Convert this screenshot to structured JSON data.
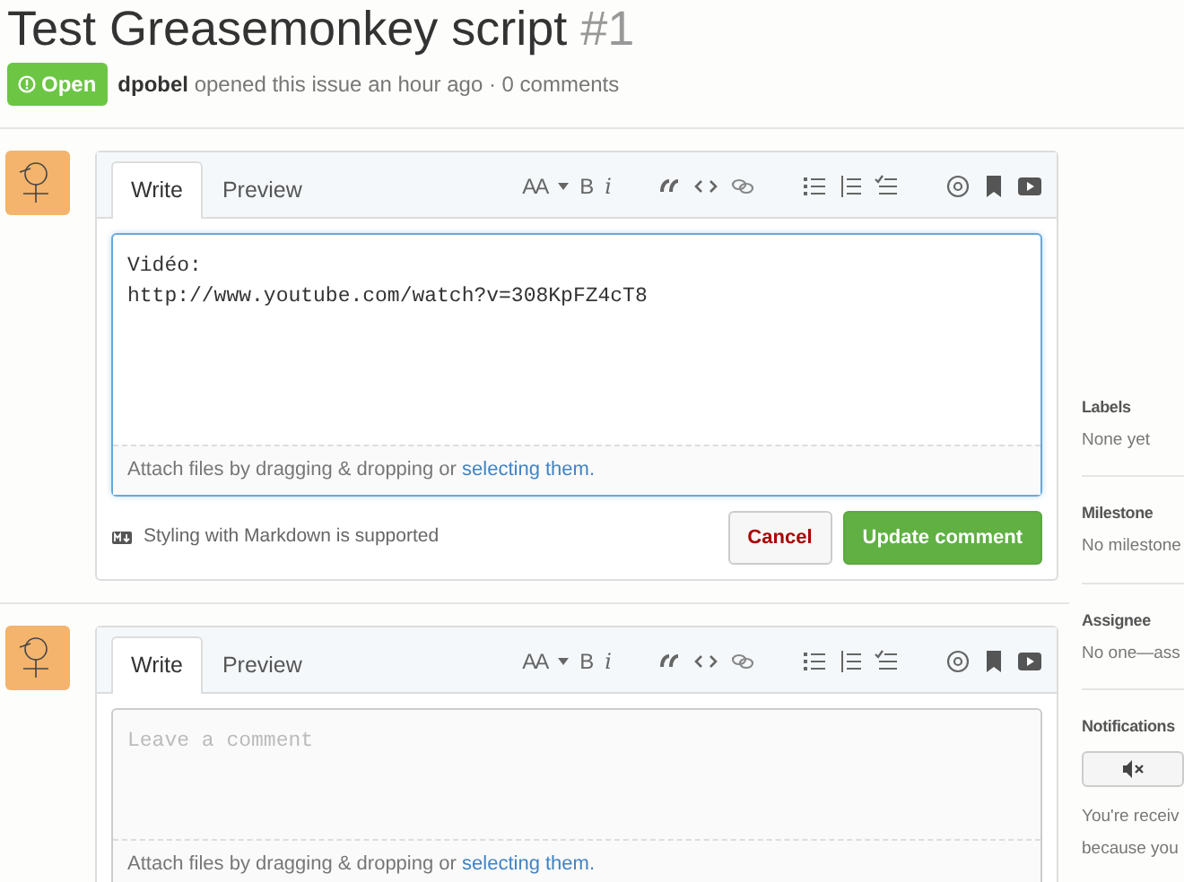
{
  "issue": {
    "title": "Test Greasemonkey script",
    "number": "#1",
    "state": "Open",
    "author": "dpobel",
    "meta": "opened this issue an hour ago · 0 comments"
  },
  "editors": [
    {
      "tabs": [
        {
          "label": "Write",
          "selected": true
        },
        {
          "label": "Preview",
          "selected": false
        }
      ],
      "toolbar": {
        "heading": "AA",
        "bold": "B",
        "italic": "i"
      },
      "value": "Vidéo:\nhttp://www.youtube.com/watch?v=308KpFZ4cT8",
      "attach": "Attach files by dragging & dropping or",
      "attach_link": "selecting them.",
      "markdown_note": "Styling with Markdown is supported",
      "buttons": [
        {
          "label": "Cancel",
          "kind": "cancel"
        },
        {
          "label": "Update comment",
          "kind": "primary"
        }
      ]
    },
    {
      "tabs": [
        {
          "label": "Write",
          "selected": true
        },
        {
          "label": "Preview",
          "selected": false
        }
      ],
      "toolbar": {
        "heading": "AA",
        "bold": "B",
        "italic": "i"
      },
      "placeholder": "Leave a comment",
      "attach": "Attach files by dragging & dropping or",
      "attach_link": "selecting them."
    }
  ],
  "sidebar": [
    {
      "heading": "Labels",
      "lines": [
        "None yet"
      ]
    },
    {
      "heading": "Milestone",
      "lines": [
        "No milestone"
      ]
    },
    {
      "heading": "Assignee",
      "lines": [
        "No one—ass"
      ]
    },
    {
      "heading": "Notifications",
      "kind": "notifications",
      "lines": [
        "You're receiv",
        "because you"
      ]
    }
  ]
}
